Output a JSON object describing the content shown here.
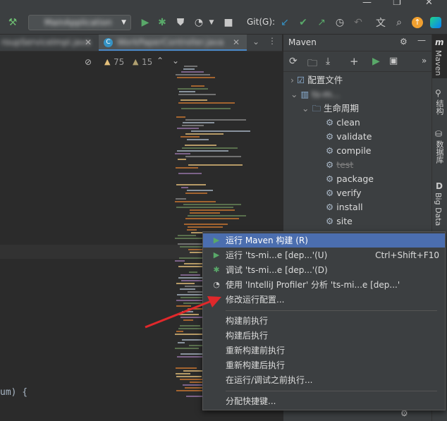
{
  "toolbar": {
    "run_config": "MainApplication",
    "git_label": "Git(G):"
  },
  "tabs": [
    {
      "label": "roupServiceImpl.java"
    },
    {
      "label": "WorkPaperController.java"
    }
  ],
  "editor": {
    "warnings": "75",
    "weak_warnings": "15",
    "code_fragment": "um) {"
  },
  "maven": {
    "title": "Maven",
    "tree": {
      "profiles": "配置文件",
      "project": "ts-m...",
      "lifecycle": "生命周期",
      "phases": [
        "clean",
        "validate",
        "compile",
        "test",
        "package",
        "verify",
        "install",
        "site"
      ]
    }
  },
  "right_strip": {
    "items": [
      "Maven",
      "结构",
      "数据库",
      "Big Data"
    ]
  },
  "context_menu": {
    "items": [
      {
        "label": "运行 Maven 构建 (R)",
        "icon": "run-icon",
        "shortcut": ""
      },
      {
        "label": "运行 'ts-mi...e [dep...'(U)",
        "icon": "run-icon",
        "shortcut": "Ctrl+Shift+F10"
      },
      {
        "label": "调试 'ts-mi...e [dep...'(D)",
        "icon": "debug-icon",
        "shortcut": ""
      },
      {
        "label": "使用 'IntelliJ Profiler' 分析 'ts-mi...e [dep...'",
        "icon": "profiler-icon",
        "shortcut": ""
      },
      {
        "label": "修改运行配置...",
        "icon": "",
        "shortcut": ""
      },
      {
        "label": "构建前执行",
        "icon": "",
        "shortcut": ""
      },
      {
        "label": "构建后执行",
        "icon": "",
        "shortcut": ""
      },
      {
        "label": "重新构建前执行",
        "icon": "",
        "shortcut": ""
      },
      {
        "label": "重新构建后执行",
        "icon": "",
        "shortcut": ""
      },
      {
        "label": "在运行/调试之前执行...",
        "icon": "",
        "shortcut": ""
      },
      {
        "label": "分配快捷键...",
        "icon": "",
        "shortcut": ""
      }
    ]
  },
  "colors": {
    "accent_red": "#e0282b",
    "selection": "#4b6eaf",
    "run_green": "#499c54",
    "warning_yellow": "#e5c07b"
  }
}
